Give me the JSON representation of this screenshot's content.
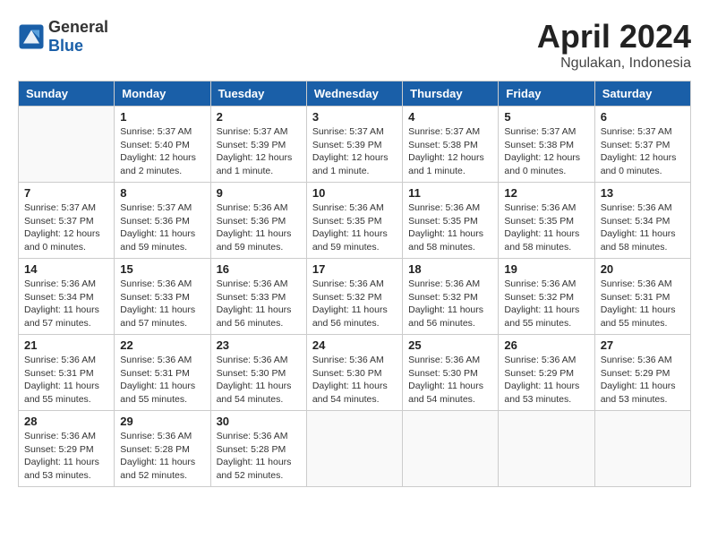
{
  "header": {
    "logo_general": "General",
    "logo_blue": "Blue",
    "month_title": "April 2024",
    "location": "Ngulakan, Indonesia"
  },
  "weekdays": [
    "Sunday",
    "Monday",
    "Tuesday",
    "Wednesday",
    "Thursday",
    "Friday",
    "Saturday"
  ],
  "weeks": [
    [
      {
        "day": "",
        "info": ""
      },
      {
        "day": "1",
        "info": "Sunrise: 5:37 AM\nSunset: 5:40 PM\nDaylight: 12 hours\nand 2 minutes."
      },
      {
        "day": "2",
        "info": "Sunrise: 5:37 AM\nSunset: 5:39 PM\nDaylight: 12 hours\nand 1 minute."
      },
      {
        "day": "3",
        "info": "Sunrise: 5:37 AM\nSunset: 5:39 PM\nDaylight: 12 hours\nand 1 minute."
      },
      {
        "day": "4",
        "info": "Sunrise: 5:37 AM\nSunset: 5:38 PM\nDaylight: 12 hours\nand 1 minute."
      },
      {
        "day": "5",
        "info": "Sunrise: 5:37 AM\nSunset: 5:38 PM\nDaylight: 12 hours\nand 0 minutes."
      },
      {
        "day": "6",
        "info": "Sunrise: 5:37 AM\nSunset: 5:37 PM\nDaylight: 12 hours\nand 0 minutes."
      }
    ],
    [
      {
        "day": "7",
        "info": "Sunrise: 5:37 AM\nSunset: 5:37 PM\nDaylight: 12 hours\nand 0 minutes."
      },
      {
        "day": "8",
        "info": "Sunrise: 5:37 AM\nSunset: 5:36 PM\nDaylight: 11 hours\nand 59 minutes."
      },
      {
        "day": "9",
        "info": "Sunrise: 5:36 AM\nSunset: 5:36 PM\nDaylight: 11 hours\nand 59 minutes."
      },
      {
        "day": "10",
        "info": "Sunrise: 5:36 AM\nSunset: 5:35 PM\nDaylight: 11 hours\nand 59 minutes."
      },
      {
        "day": "11",
        "info": "Sunrise: 5:36 AM\nSunset: 5:35 PM\nDaylight: 11 hours\nand 58 minutes."
      },
      {
        "day": "12",
        "info": "Sunrise: 5:36 AM\nSunset: 5:35 PM\nDaylight: 11 hours\nand 58 minutes."
      },
      {
        "day": "13",
        "info": "Sunrise: 5:36 AM\nSunset: 5:34 PM\nDaylight: 11 hours\nand 58 minutes."
      }
    ],
    [
      {
        "day": "14",
        "info": "Sunrise: 5:36 AM\nSunset: 5:34 PM\nDaylight: 11 hours\nand 57 minutes."
      },
      {
        "day": "15",
        "info": "Sunrise: 5:36 AM\nSunset: 5:33 PM\nDaylight: 11 hours\nand 57 minutes."
      },
      {
        "day": "16",
        "info": "Sunrise: 5:36 AM\nSunset: 5:33 PM\nDaylight: 11 hours\nand 56 minutes."
      },
      {
        "day": "17",
        "info": "Sunrise: 5:36 AM\nSunset: 5:32 PM\nDaylight: 11 hours\nand 56 minutes."
      },
      {
        "day": "18",
        "info": "Sunrise: 5:36 AM\nSunset: 5:32 PM\nDaylight: 11 hours\nand 56 minutes."
      },
      {
        "day": "19",
        "info": "Sunrise: 5:36 AM\nSunset: 5:32 PM\nDaylight: 11 hours\nand 55 minutes."
      },
      {
        "day": "20",
        "info": "Sunrise: 5:36 AM\nSunset: 5:31 PM\nDaylight: 11 hours\nand 55 minutes."
      }
    ],
    [
      {
        "day": "21",
        "info": "Sunrise: 5:36 AM\nSunset: 5:31 PM\nDaylight: 11 hours\nand 55 minutes."
      },
      {
        "day": "22",
        "info": "Sunrise: 5:36 AM\nSunset: 5:31 PM\nDaylight: 11 hours\nand 55 minutes."
      },
      {
        "day": "23",
        "info": "Sunrise: 5:36 AM\nSunset: 5:30 PM\nDaylight: 11 hours\nand 54 minutes."
      },
      {
        "day": "24",
        "info": "Sunrise: 5:36 AM\nSunset: 5:30 PM\nDaylight: 11 hours\nand 54 minutes."
      },
      {
        "day": "25",
        "info": "Sunrise: 5:36 AM\nSunset: 5:30 PM\nDaylight: 11 hours\nand 54 minutes."
      },
      {
        "day": "26",
        "info": "Sunrise: 5:36 AM\nSunset: 5:29 PM\nDaylight: 11 hours\nand 53 minutes."
      },
      {
        "day": "27",
        "info": "Sunrise: 5:36 AM\nSunset: 5:29 PM\nDaylight: 11 hours\nand 53 minutes."
      }
    ],
    [
      {
        "day": "28",
        "info": "Sunrise: 5:36 AM\nSunset: 5:29 PM\nDaylight: 11 hours\nand 53 minutes."
      },
      {
        "day": "29",
        "info": "Sunrise: 5:36 AM\nSunset: 5:28 PM\nDaylight: 11 hours\nand 52 minutes."
      },
      {
        "day": "30",
        "info": "Sunrise: 5:36 AM\nSunset: 5:28 PM\nDaylight: 11 hours\nand 52 minutes."
      },
      {
        "day": "",
        "info": ""
      },
      {
        "day": "",
        "info": ""
      },
      {
        "day": "",
        "info": ""
      },
      {
        "day": "",
        "info": ""
      }
    ]
  ]
}
